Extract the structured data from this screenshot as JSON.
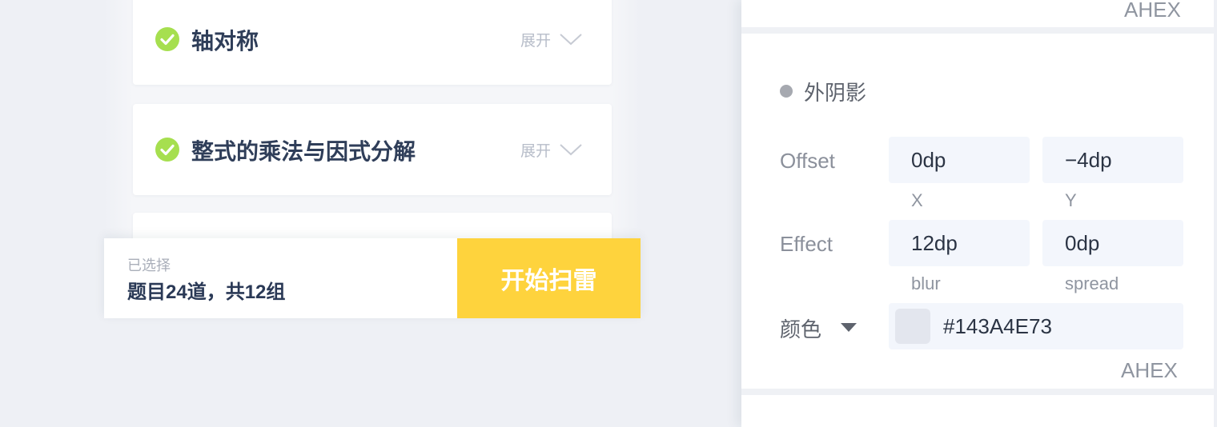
{
  "preview": {
    "cards": [
      {
        "title": "轴对称",
        "expand_label": "展开"
      },
      {
        "title": "整式的乘法与因式分解",
        "expand_label": "展开"
      }
    ],
    "footer": {
      "selected_label": "已选择",
      "selected_summary": "题目24道，共12组",
      "start_button": "开始扫雷"
    }
  },
  "panel": {
    "top_format_label": "AHEX",
    "section_title": "外阴影",
    "offset": {
      "label": "Offset",
      "x_value": "0dp",
      "x_label": "X",
      "y_value": "−4dp",
      "y_label": "Y"
    },
    "effect": {
      "label": "Effect",
      "blur_value": "12dp",
      "blur_label": "blur",
      "spread_value": "0dp",
      "spread_label": "spread"
    },
    "color": {
      "label": "颜色",
      "value": "#143A4E73",
      "format_label": "AHEX"
    }
  },
  "colors": {
    "accent_yellow": "#fed33d",
    "check_green": "#a6df4f",
    "field_bg": "#f3f6fc",
    "canvas_bg": "#eef0f5",
    "shadow_color": "#143A4E73"
  },
  "icons": [
    "check-circle-icon",
    "chevron-down-icon",
    "dropdown-triangle-icon"
  ]
}
